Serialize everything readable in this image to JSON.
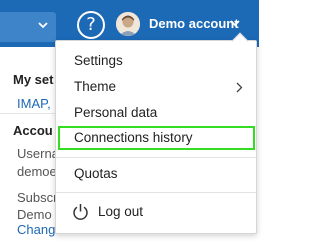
{
  "header": {
    "help_glyph": "?",
    "account_label": "Demo account"
  },
  "left_panel": {
    "section_title": "My set",
    "imap_link": "IMAP,",
    "account_title": "Accou",
    "username_label": "Userna",
    "username_value": "demoe",
    "subscription_label": "Subscr",
    "subscription_value": "Demo",
    "change_link": "Chang"
  },
  "menu": {
    "items": [
      {
        "label": "Settings"
      },
      {
        "label": "Theme"
      },
      {
        "label": "Personal data"
      },
      {
        "label": "Connections history"
      },
      {
        "label": "Quotas"
      },
      {
        "label": "Log out"
      }
    ],
    "highlighted_item": "Connections history",
    "highlight_color": "#33dd22"
  },
  "colors": {
    "header_bg": "#1c69b6",
    "link": "#1c69b6"
  }
}
